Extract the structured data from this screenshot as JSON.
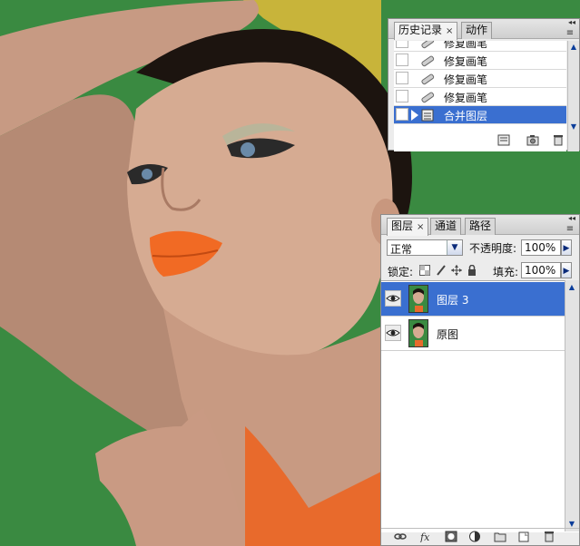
{
  "history_panel": {
    "tabs": [
      {
        "label": "历史记录",
        "active": true,
        "close": "×"
      },
      {
        "label": "动作",
        "active": false
      }
    ],
    "items": [
      {
        "label": "修复画笔",
        "icon": "healing-brush-icon",
        "selected": false
      },
      {
        "label": "修复画笔",
        "icon": "healing-brush-icon",
        "selected": false
      },
      {
        "label": "修复画笔",
        "icon": "healing-brush-icon",
        "selected": false
      },
      {
        "label": "修复画笔",
        "icon": "healing-brush-icon",
        "selected": false
      },
      {
        "label": "合并图层",
        "icon": "merge-layers-icon",
        "selected": true
      }
    ],
    "footer_icons": [
      "new-document-from-state-icon",
      "snapshot-camera-icon",
      "trash-icon"
    ]
  },
  "layers_panel": {
    "tabs": [
      {
        "label": "图层",
        "active": true,
        "close": "×"
      },
      {
        "label": "通道",
        "active": false
      },
      {
        "label": "路径",
        "active": false
      }
    ],
    "blend_mode": "正常",
    "opacity_label": "不透明度:",
    "opacity_value": "100%",
    "lock_label": "锁定:",
    "fill_label": "填充:",
    "fill_value": "100%",
    "layers": [
      {
        "name": "图层 3",
        "visible": true,
        "selected": true
      },
      {
        "name": "原图",
        "visible": true,
        "selected": false
      }
    ],
    "footer_icons": [
      "link-icon",
      "fx-icon",
      "mask-icon",
      "adjustment-icon",
      "group-folder-icon",
      "new-layer-icon",
      "trash-icon"
    ]
  },
  "colors": {
    "background_green": "#3a8a41",
    "selection_blue": "#3a6fd0",
    "panel_gray": "#ececec"
  }
}
